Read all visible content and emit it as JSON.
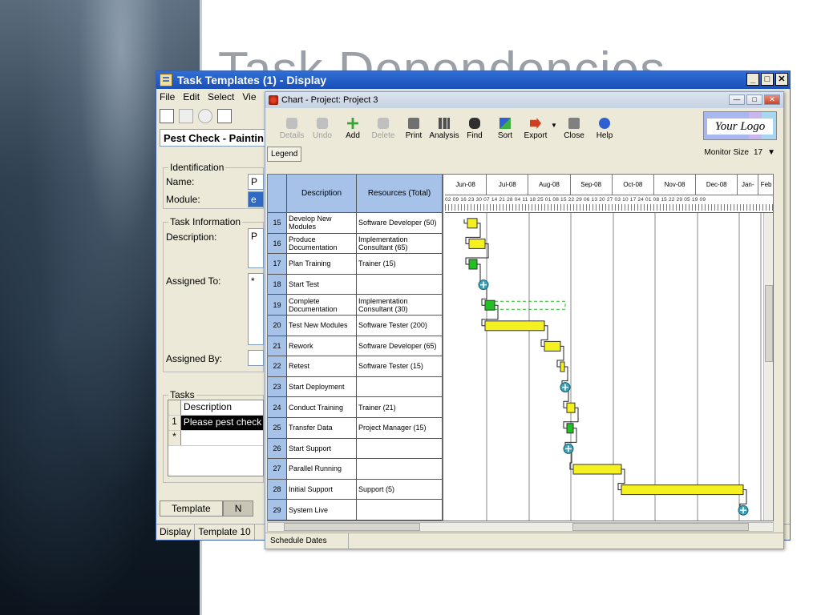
{
  "slide": {
    "title": "Task Dependencies"
  },
  "back_window": {
    "title": "Task Templates (1) - Display",
    "menu": [
      "File",
      "Edit",
      "Select",
      "Vie"
    ],
    "template_name": "Pest Check - Paintin",
    "identification": {
      "legend": "Identification",
      "name_label": "Name:",
      "name_value": "P",
      "module_label": "Module:",
      "module_value": "e"
    },
    "task_info": {
      "legend": "Task Information",
      "description_label": "Description:",
      "description_value": "P",
      "assigned_to_label": "Assigned To:",
      "assigned_to_value": "*",
      "assigned_by_label": "Assigned By:"
    },
    "tasks": {
      "legend": "Tasks",
      "header": "Description",
      "rows": [
        {
          "num": "1",
          "text": "Please pest check"
        },
        {
          "num": "*",
          "text": ""
        }
      ]
    },
    "tabs": [
      "Template",
      "N"
    ],
    "status": [
      "Display",
      "Template 10"
    ]
  },
  "chart_window": {
    "title": "Chart - Project: Project 3",
    "toolbar": [
      {
        "label": "Details",
        "icon": "details-icon",
        "enabled": false
      },
      {
        "label": "Undo",
        "icon": "undo-icon",
        "enabled": false
      },
      {
        "label": "Add",
        "icon": "add-icon",
        "enabled": true
      },
      {
        "label": "Delete",
        "icon": "delete-icon",
        "enabled": false
      },
      {
        "label": "Print",
        "icon": "print-icon",
        "enabled": true
      },
      {
        "label": "Analysis",
        "icon": "analysis-icon",
        "enabled": true
      },
      {
        "label": "Find",
        "icon": "find-icon",
        "enabled": true
      },
      {
        "label": "Sort",
        "icon": "sort-icon",
        "enabled": true
      },
      {
        "label": "Export",
        "icon": "export-icon",
        "enabled": true
      },
      {
        "label": "Close",
        "icon": "close-icon",
        "enabled": true
      },
      {
        "label": "Help",
        "icon": "help-icon",
        "enabled": true
      }
    ],
    "logo_text": "Your Logo",
    "legend_button": "Legend",
    "monitor_label": "Monitor Size",
    "monitor_value": "17",
    "columns": {
      "description": "Description",
      "resources": "Resources (Total)"
    },
    "months": [
      "Jun-08",
      "Jul-08",
      "Aug-08",
      "Sep-08",
      "Oct-08",
      "Nov-08",
      "Dec-08",
      "Jan-",
      "Feb"
    ],
    "day_ticks": "02 09 16 23 30 07 14 21 28 04 11 18 25 01 08 15 22 29 06 13 20 27 03 10 17 24 01 08 15 22 29 05  19  09",
    "tasks": [
      {
        "id": "15",
        "description": "Develop New Modules",
        "resources": "Software Developer (50)"
      },
      {
        "id": "16",
        "description": "Produce Documentation",
        "resources": "Implementation Consultant (65)"
      },
      {
        "id": "17",
        "description": "Plan Training",
        "resources": "Trainer (15)"
      },
      {
        "id": "18",
        "description": "Start Test",
        "resources": ""
      },
      {
        "id": "19",
        "description": "Complete Documentation",
        "resources": "Implementation Consultant (30)"
      },
      {
        "id": "20",
        "description": "Test New Modules",
        "resources": "Software Tester (200)"
      },
      {
        "id": "21",
        "description": "Rework",
        "resources": "Software Developer (65)"
      },
      {
        "id": "22",
        "description": "Retest",
        "resources": "Software Tester (15)"
      },
      {
        "id": "23",
        "description": "Start Deployment",
        "resources": ""
      },
      {
        "id": "24",
        "description": "Conduct Training",
        "resources": "Trainer (21)"
      },
      {
        "id": "25",
        "description": "Transfer Data",
        "resources": "Project Manager (15)"
      },
      {
        "id": "26",
        "description": "Start Support",
        "resources": ""
      },
      {
        "id": "27",
        "description": "Parallel Running",
        "resources": ""
      },
      {
        "id": "28",
        "description": "Initial Support",
        "resources": "Support (5)"
      },
      {
        "id": "29",
        "description": "System Live",
        "resources": ""
      }
    ],
    "status_tab": "Schedule Dates",
    "colors": {
      "task_bar": "#f5f020",
      "complete_bar": "#22c022",
      "milestone": "#3aa0b8",
      "header": "#a6c2e8"
    }
  }
}
